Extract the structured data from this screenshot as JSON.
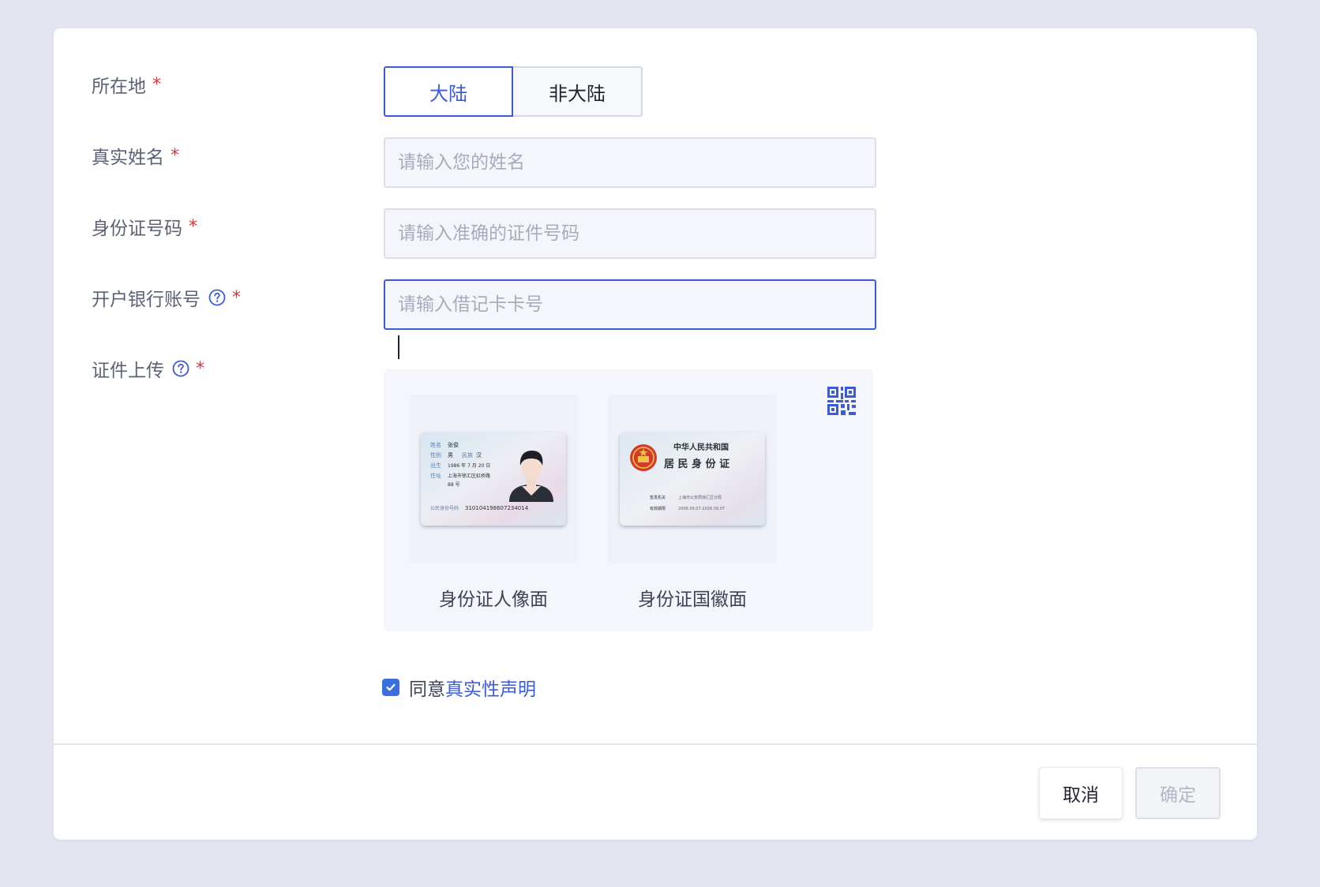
{
  "form": {
    "location": {
      "label": "所在地",
      "options": [
        "大陆",
        "非大陆"
      ],
      "selected": "大陆"
    },
    "real_name": {
      "label": "真实姓名",
      "placeholder": "请输入您的姓名",
      "value": ""
    },
    "id_number": {
      "label": "身份证号码",
      "placeholder": "请输入准确的证件号码",
      "value": ""
    },
    "bank_account": {
      "label": "开户银行账号",
      "placeholder": "请输入借记卡卡号",
      "value": ""
    },
    "upload": {
      "label": "证件上传",
      "front_label": "身份证人像面",
      "back_label": "身份证国徽面",
      "front_card": {
        "name_key": "姓名",
        "name": "张俊",
        "gender_key": "性别",
        "gender": "男",
        "ethnicity_key": "民族",
        "ethnicity": "汉",
        "birth_key": "出生",
        "birth": "1986 年 7 月 20 日",
        "address_key": "住址",
        "address": "上海市徐汇区虹桥路",
        "address2": "88 号",
        "id_key": "公民身份号码",
        "id": "310104198607234014"
      },
      "back_card": {
        "country": "中华人民共和国",
        "title": "居 民 身 份 证",
        "authority_key": "签发机关",
        "authority": "上海市公安局徐汇区分局",
        "validity_key": "有效期限",
        "validity": "2006.09.07-2026.09.07"
      }
    },
    "required_mark": "*",
    "agreement": {
      "checked": true,
      "prefix": "同意",
      "link": "真实性声明"
    }
  },
  "footer": {
    "cancel_label": "取消",
    "ok_label": "确定"
  },
  "icons": {
    "help": "help-circle-icon",
    "qr": "qr-code-icon",
    "check": "check-icon"
  },
  "colors": {
    "accent": "#3b5bd9",
    "required": "#e03535",
    "background": "#e2e4ef"
  }
}
